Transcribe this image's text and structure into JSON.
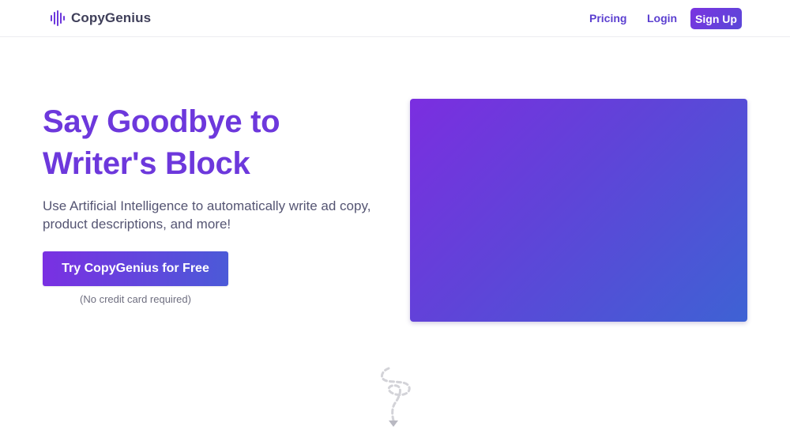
{
  "header": {
    "brand": "CopyGenius",
    "nav": {
      "pricing": "Pricing",
      "login": "Login",
      "signup": "Sign Up"
    }
  },
  "hero": {
    "title_line1": "Say Goodbye to",
    "title_line2": "Writer's Block",
    "subtitle_line1": "Use Artificial Intelligence to automatically write ad copy,",
    "subtitle_line2": "product descriptions, and more!",
    "cta_label": "Try CopyGenius for Free",
    "cta_note": "(No credit card required)"
  },
  "icons": {
    "logo": "sound-wave-icon",
    "scroll": "dashed-arrow-down-icon"
  },
  "colors": {
    "accent": "#6d38dc",
    "gradient_start": "#7b2ee0",
    "gradient_end": "#3e62d4"
  }
}
